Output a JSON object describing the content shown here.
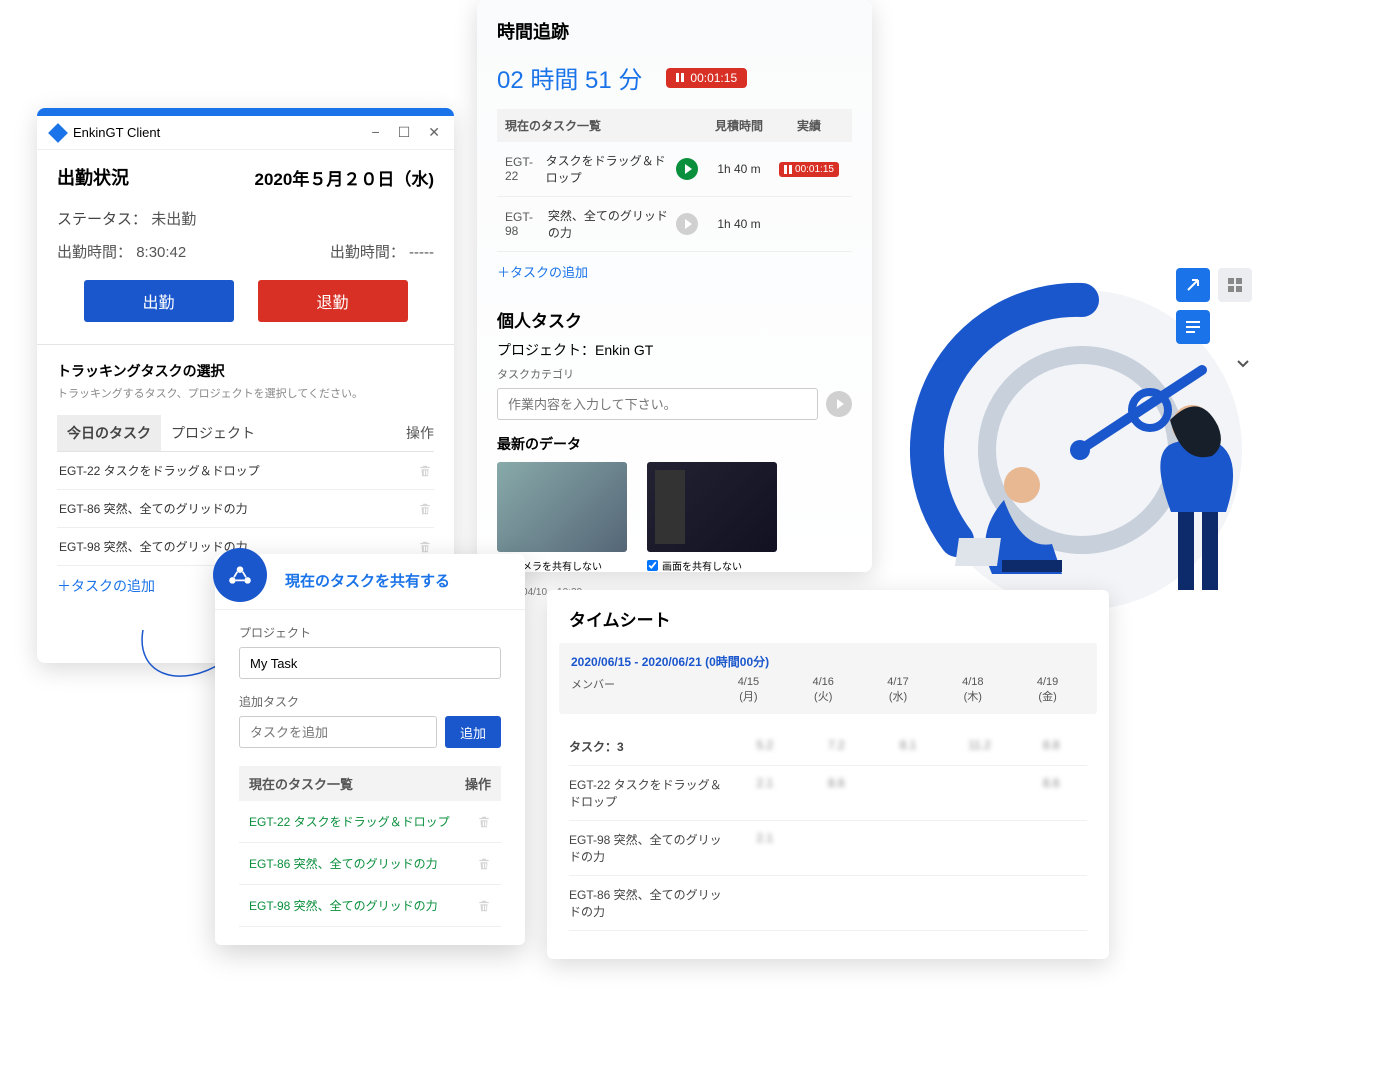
{
  "panel1": {
    "app_title": "EnkinGT Client",
    "heading": "出勤状況",
    "date": "2020年５月２０日（水)",
    "status_label": "ステータス：",
    "status_value": "未出勤",
    "checkin_label": "出勤時間：",
    "checkin_value": "8:30:42",
    "checkout_label": "出勤時間：",
    "checkout_value": "-----",
    "btn_checkin": "出勤",
    "btn_checkout": "退勤",
    "select_title": "トラッキングタスクの選択",
    "select_sub": "トラッキングするタスク、プロジェクトを選択してください。",
    "tab_today": "今日のタスク",
    "tab_project": "プロジェクト",
    "tab_ops": "操作",
    "tasks": [
      {
        "id": "EGT-22",
        "name": "タスクをドラッグ＆ドロップ"
      },
      {
        "id": "EGT-86",
        "name": "突然、全てのグリッドの力"
      },
      {
        "id": "EGT-98",
        "name": "突然、全てのグリッドの力"
      }
    ],
    "add_task": "＋タスクの追加"
  },
  "popup": {
    "title": "現在のタスクを共有する",
    "label_project": "プロジェクト",
    "project_value": "My Task",
    "label_add": "追加タスク",
    "add_placeholder": "タスクを追加",
    "btn_add": "追加",
    "list_title": "現在のタスク一覧",
    "list_ops": "操作",
    "items": [
      {
        "id": "EGT-22",
        "name": "タスクをドラッグ＆ドロップ"
      },
      {
        "id": "EGT-86",
        "name": "突然、全てのグリッドの力"
      },
      {
        "id": "EGT-98",
        "name": "突然、全てのグリッドの力"
      }
    ]
  },
  "panel2": {
    "heading": "時間追跡",
    "big_time": "02 時間 51 分",
    "timer_badge": "00:01:15",
    "col_name": "現在のタスク一覧",
    "col_est": "見積時間",
    "col_act": "実績",
    "rows": [
      {
        "id": "EGT-22",
        "name": "タスクをドラッグ＆ドロップ",
        "est": "1h 40 m",
        "act": "00:01:15",
        "running": true
      },
      {
        "id": "EGT-98",
        "name": "突然、全てのグリッドの力",
        "est": "1h 40 m",
        "act": "",
        "running": false
      }
    ],
    "add_task": "＋タスクの追加",
    "personal_heading": "個人タスク",
    "project_line": "プロジェクト：Enkin GT",
    "category_label": "タスクカテゴリ",
    "input_placeholder": "作業内容を入力して下さい。",
    "latest_heading": "最新のデータ",
    "snap1_label": "カメラを共有しない",
    "snap2_label": "画面を共有しない",
    "timestamp": "2020/04/10　10:20"
  },
  "panel3": {
    "heading": "タイムシート",
    "range": "2020/06/15 - 2020/06/21 (0時間00分)",
    "member_label": "メンバー",
    "days": [
      {
        "d": "4/15",
        "w": "(月)"
      },
      {
        "d": "4/16",
        "w": "(火)"
      },
      {
        "d": "4/17",
        "w": "(水)"
      },
      {
        "d": "4/18",
        "w": "(木)"
      },
      {
        "d": "4/19",
        "w": "(金)"
      }
    ],
    "task_count_label": "タスク：3",
    "totals": [
      "5.2",
      "7.2",
      "8.1",
      "11.2",
      "8.8"
    ],
    "rows": [
      {
        "label": "EGT-22 タスクをドラッグ＆ドロップ",
        "vals": [
          "2.1",
          "8.6",
          "",
          "",
          "8.6"
        ]
      },
      {
        "label": "EGT-98 突然、全てのグリッドの力",
        "vals": [
          "2.1",
          "",
          "",
          "",
          ""
        ]
      },
      {
        "label": "EGT-86 突然、全てのグリッドの力",
        "vals": [
          "",
          "",
          "",
          "",
          ""
        ]
      }
    ]
  }
}
